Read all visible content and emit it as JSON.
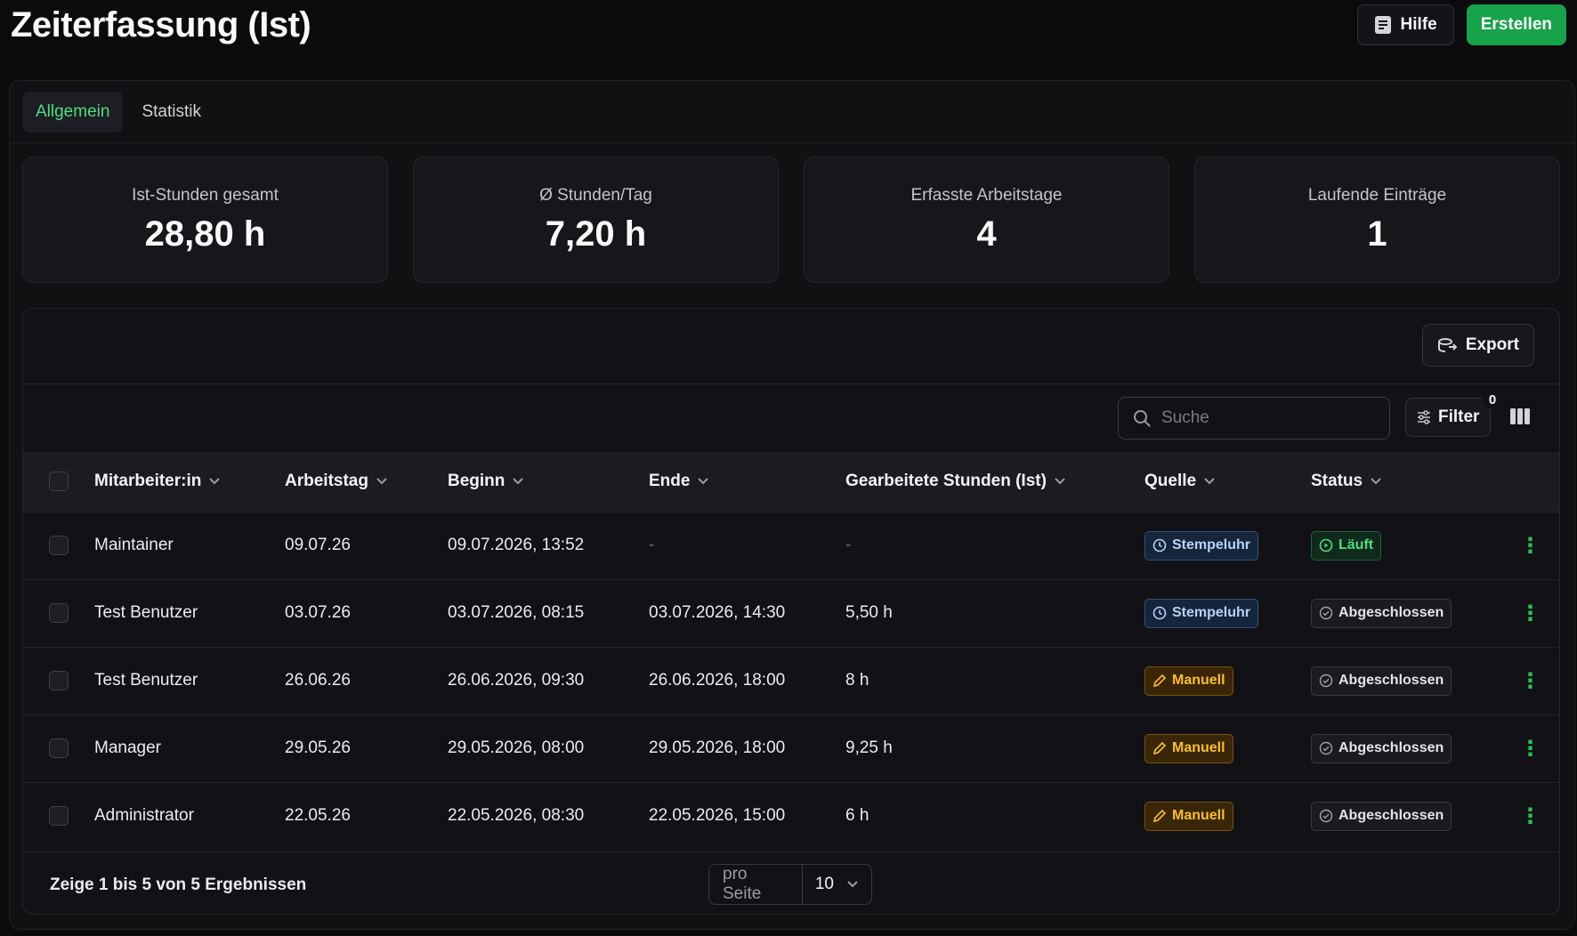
{
  "header": {
    "title": "Zeiterfassung (Ist)",
    "help_label": "Hilfe",
    "create_label": "Erstellen"
  },
  "tabs": [
    {
      "label": "Allgemein",
      "active": true
    },
    {
      "label": "Statistik",
      "active": false
    }
  ],
  "stats": [
    {
      "label": "Ist-Stunden gesamt",
      "value": "28,80 h"
    },
    {
      "label": "Ø Stunden/Tag",
      "value": "7,20 h"
    },
    {
      "label": "Erfasste Arbeitstage",
      "value": "4"
    },
    {
      "label": "Laufende Einträge",
      "value": "1"
    }
  ],
  "toolbar": {
    "export_label": "Export",
    "search_placeholder": "Suche",
    "filter_label": "Filter",
    "filter_count": "0"
  },
  "table": {
    "columns": [
      "Mitarbeiter:in",
      "Arbeitstag",
      "Beginn",
      "Ende",
      "Gearbeitete Stunden (Ist)",
      "Quelle",
      "Status"
    ],
    "rows": [
      {
        "employee": "Maintainer",
        "day": "09.07.26",
        "start": "09.07.2026, 13:52",
        "end": "-",
        "hours": "-",
        "source": "Stempeluhr",
        "source_type": "stempel",
        "status": "Läuft",
        "status_type": "running"
      },
      {
        "employee": "Test Benutzer",
        "day": "03.07.26",
        "start": "03.07.2026, 08:15",
        "end": "03.07.2026, 14:30",
        "hours": "5,50 h",
        "source": "Stempeluhr",
        "source_type": "stempel",
        "status": "Abgeschlossen",
        "status_type": "done"
      },
      {
        "employee": "Test Benutzer",
        "day": "26.06.26",
        "start": "26.06.2026, 09:30",
        "end": "26.06.2026, 18:00",
        "hours": "8 h",
        "source": "Manuell",
        "source_type": "manual",
        "status": "Abgeschlossen",
        "status_type": "done"
      },
      {
        "employee": "Manager",
        "day": "29.05.26",
        "start": "29.05.2026, 08:00",
        "end": "29.05.2026, 18:00",
        "hours": "9,25 h",
        "source": "Manuell",
        "source_type": "manual",
        "status": "Abgeschlossen",
        "status_type": "done"
      },
      {
        "employee": "Administrator",
        "day": "22.05.26",
        "start": "22.05.2026, 08:30",
        "end": "22.05.2026, 15:00",
        "hours": "6 h",
        "source": "Manuell",
        "source_type": "manual",
        "status": "Abgeschlossen",
        "status_type": "done"
      }
    ]
  },
  "footer": {
    "results_text": "Zeige 1 bis 5 von 5 Ergebnissen",
    "per_page_label": "pro Seite",
    "per_page_value": "10"
  },
  "colors": {
    "accent": "#16a34a",
    "tab_active": "#4ade80",
    "stempel": "#b9d3f5",
    "manual": "#fbbf24",
    "running": "#4ade80"
  }
}
